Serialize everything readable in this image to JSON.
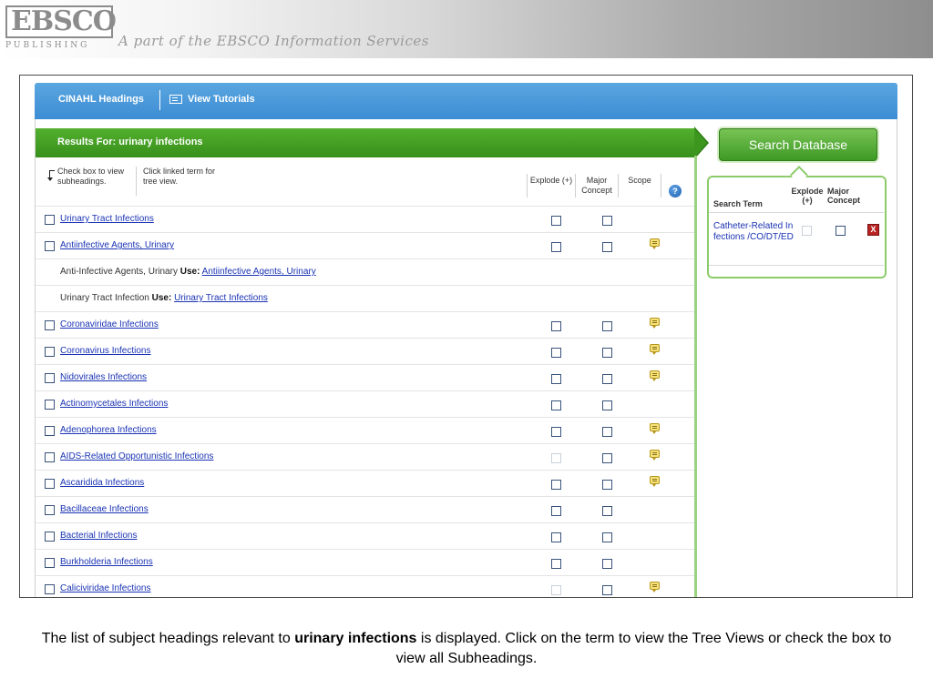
{
  "banner": {
    "logo_top": "EBSCO",
    "logo_bottom": "PUBLISHING",
    "tagline": "A part of the EBSCO Information Services"
  },
  "topbar": {
    "headings_label": "CINAHL Headings",
    "tutorials_label": "View Tutorials"
  },
  "results": {
    "title": "Results For: urinary infections",
    "hint_checkbox": "Check box to view subheadings.",
    "hint_link": "Click linked term for tree view.",
    "col_explode": "Explode (+)",
    "col_major": "Major Concept",
    "col_scope": "Scope",
    "help": "?"
  },
  "rows": [
    {
      "type": "term",
      "label": "Urinary Tract Infections",
      "explode_enabled": true,
      "scope": false
    },
    {
      "type": "term",
      "label": "Antiinfective Agents, Urinary",
      "explode_enabled": true,
      "scope": true
    },
    {
      "type": "use",
      "label": "Anti-Infective Agents, Urinary",
      "use_word": "Use:",
      "use_target": "Antiinfective Agents, Urinary"
    },
    {
      "type": "use",
      "label": "Urinary Tract Infection",
      "use_word": "Use:",
      "use_target": "Urinary Tract Infections"
    },
    {
      "type": "term",
      "label": "Coronaviridae Infections",
      "explode_enabled": true,
      "scope": true
    },
    {
      "type": "term",
      "label": "Coronavirus Infections",
      "explode_enabled": true,
      "scope": true
    },
    {
      "type": "term",
      "label": "Nidovirales Infections",
      "explode_enabled": true,
      "scope": true
    },
    {
      "type": "term",
      "label": "Actinomycetales Infections",
      "explode_enabled": true,
      "scope": false
    },
    {
      "type": "term",
      "label": "Adenophorea Infections",
      "explode_enabled": true,
      "scope": true
    },
    {
      "type": "term",
      "label": "AIDS-Related Opportunistic Infections",
      "explode_enabled": false,
      "scope": true
    },
    {
      "type": "term",
      "label": "Ascaridida Infections",
      "explode_enabled": true,
      "scope": true
    },
    {
      "type": "term",
      "label": "Bacillaceae Infections",
      "explode_enabled": true,
      "scope": false
    },
    {
      "type": "term",
      "label": "Bacterial Infections",
      "explode_enabled": true,
      "scope": false
    },
    {
      "type": "term",
      "label": "Burkholderia Infections",
      "explode_enabled": true,
      "scope": false
    },
    {
      "type": "term",
      "label": "Caliciviridae Infections",
      "explode_enabled": false,
      "scope": true
    }
  ],
  "search": {
    "button_label": "Search Database",
    "col_term": "Search Term",
    "col_explode": "Explode (+)",
    "col_major": "Major Concept",
    "selected_term": "Catheter-Related Infections /CO/DT/ED",
    "delete_label": "X"
  },
  "caption": {
    "before": "The list of subject headings relevant to ",
    "bold": "urinary infections",
    "after": " is displayed. Click on the term to view the Tree Views or check the box to view all Subheadings."
  },
  "colors": {
    "header_blue": "#3d8dd4",
    "results_green": "#3d971f",
    "link_blue": "#1a33b4"
  }
}
